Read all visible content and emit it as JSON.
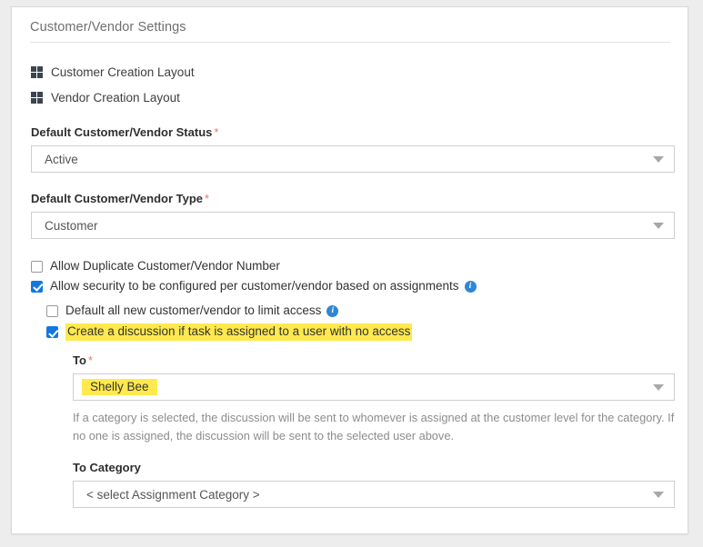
{
  "panel": {
    "title": "Customer/Vendor Settings"
  },
  "layout_links": [
    {
      "label": "Customer Creation Layout",
      "icon": "grid-icon"
    },
    {
      "label": "Vendor Creation Layout",
      "icon": "grid-icon"
    }
  ],
  "fields": {
    "status": {
      "label": "Default Customer/Vendor Status",
      "required_marker": "*",
      "value": "Active"
    },
    "type": {
      "label": "Default Customer/Vendor Type",
      "required_marker": "*",
      "value": "Customer"
    },
    "to": {
      "label": "To",
      "required_marker": "*",
      "value": "Shelly Bee",
      "highlighted": true
    },
    "to_category": {
      "label": "To Category",
      "value": "< select Assignment Category >"
    }
  },
  "checkboxes": {
    "allow_duplicate": {
      "label": "Allow Duplicate Customer/Vendor Number",
      "checked": false
    },
    "allow_security": {
      "label": "Allow security to be configured per customer/vendor based on assignments",
      "checked": true,
      "info": "i"
    },
    "default_limit_access": {
      "label": "Default all new customer/vendor to limit access",
      "checked": false,
      "info": "i"
    },
    "create_discussion": {
      "label": "Create a discussion if task is assigned to a user with no access",
      "checked": true,
      "highlighted": true
    }
  },
  "help_text": "If a category is selected, the discussion will be sent to whomever is assigned at the customer level for the category. If no one is assigned, the discussion will be sent to the selected user above.",
  "colors": {
    "accent_blue": "#1277e1",
    "info_blue": "#2f86d6",
    "highlight_yellow": "#ffe94d",
    "required_red": "#e8746a",
    "icon_slate": "#3c4450"
  }
}
